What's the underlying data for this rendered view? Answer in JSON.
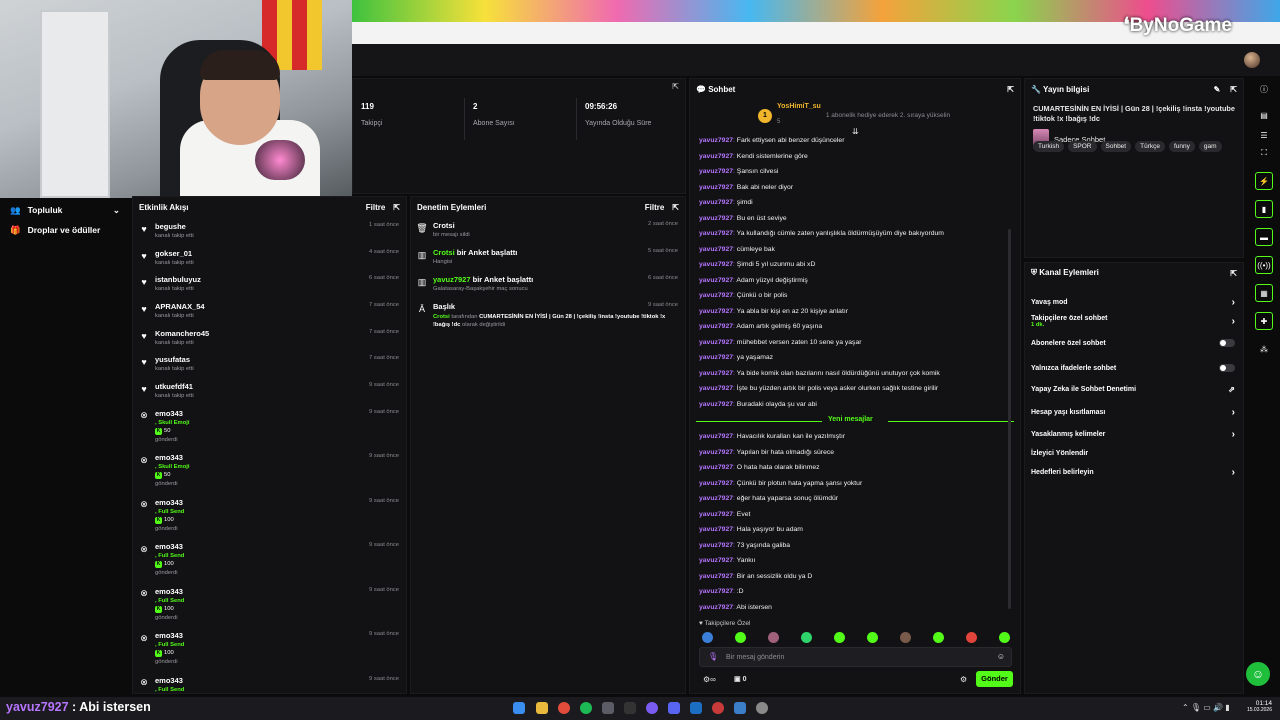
{
  "brand": {
    "logo_text": "ByNoGame"
  },
  "stats": [
    {
      "value": "119",
      "label": "Takipçi"
    },
    {
      "value": "2",
      "label": "Abone Sayısı"
    },
    {
      "value": "09:56:26",
      "label": "Yayında Olduğu Süre"
    }
  ],
  "sidebar": {
    "items": [
      {
        "label": "Topluluk",
        "icon": "community-icon"
      },
      {
        "label": "Droplar ve ödüller",
        "icon": "gift-icon"
      }
    ]
  },
  "activity": {
    "title": "Etkinlik Akışı",
    "filter": "Filtre",
    "items": [
      {
        "icon": "heart-icon",
        "name": "begushe",
        "sub": "kanalı takip etti",
        "time": "1 saat önce"
      },
      {
        "icon": "heart-icon",
        "name": "gokser_01",
        "sub": "kanalı takip etti",
        "time": "4 saat önce"
      },
      {
        "icon": "heart-icon",
        "name": "istanbuluyuz",
        "sub": "kanalı takip etti",
        "time": "6 saat önce"
      },
      {
        "icon": "heart-icon",
        "name": "APRANAX_54",
        "sub": "kanalı takip etti",
        "time": "7 saat önce"
      },
      {
        "icon": "heart-icon",
        "name": "Komanchero45",
        "sub": "kanalı takip etti",
        "time": "7 saat önce"
      },
      {
        "icon": "heart-icon",
        "name": "yusufatas",
        "sub": "kanalı takip etti",
        "time": "7 saat önce"
      },
      {
        "icon": "heart-icon",
        "name": "utkuefdf41",
        "sub": "kanalı takip etti",
        "time": "9 saat önce"
      },
      {
        "icon": "kick-icon",
        "name": "emo343",
        "gift": ", Skull Emoji",
        "amount": "50",
        "sub": "gönderdi",
        "time": "9 saat önce"
      },
      {
        "icon": "kick-icon",
        "name": "emo343",
        "gift": ", Skull Emoji",
        "amount": "50",
        "sub": "gönderdi",
        "time": "9 saat önce"
      },
      {
        "icon": "kick-icon",
        "name": "emo343",
        "gift": ", Full Send",
        "amount": "100",
        "sub": "gönderdi",
        "time": "9 saat önce"
      },
      {
        "icon": "kick-icon",
        "name": "emo343",
        "gift": ", Full Send",
        "amount": "100",
        "sub": "gönderdi",
        "time": "9 saat önce"
      },
      {
        "icon": "kick-icon",
        "name": "emo343",
        "gift": ", Full Send",
        "amount": "100",
        "sub": "gönderdi",
        "time": "9 saat önce"
      },
      {
        "icon": "kick-icon",
        "name": "emo343",
        "gift": ", Full Send",
        "amount": "100",
        "sub": "gönderdi",
        "time": "9 saat önce"
      },
      {
        "icon": "kick-icon",
        "name": "emo343",
        "gift": ", Full Send",
        "amount": "",
        "sub": "",
        "time": "9 saat önce"
      }
    ]
  },
  "moderation": {
    "title": "Denetim Eylemleri",
    "filter": "Filtre",
    "items": [
      {
        "icon": "trash-icon",
        "title": "Crotsi",
        "sub": "bir mesajı sildi",
        "time": "2 saat önce"
      },
      {
        "icon": "poll-icon",
        "user": "Crotsi",
        "title": " bir Anket başlattı",
        "sub": "Hangisi",
        "time": "5 saat önce"
      },
      {
        "icon": "poll-icon",
        "user": "yavuz7927",
        "title": " bir Anket başlattı",
        "sub": "Galatasaray-Başakşehir maç sonucu",
        "time": "6 saat önce"
      },
      {
        "icon": "title-icon",
        "title": "Başlık",
        "user": "Crotsi",
        "sub_mid": " tarafından ",
        "sub_bold": "CUMARTESİNİN EN İYİSİ | Gün 28 | !çekiliş !insta !youtube !tiktok !x !bağış !dc",
        "sub_end": " olarak değiştirildi",
        "time": "9 saat önce"
      }
    ]
  },
  "chat": {
    "title": "Sohbet",
    "pinned_user": "YosHimiT_su",
    "pinned_count": "5",
    "pinned_text": "1 abonelik hediye ederek 2. sıraya yükselin",
    "new_messages": "Yeni mesajlar",
    "messages_before": [
      {
        "user": "yavuz7927",
        "text": "Fark ettiysen abi benzer düşünceler"
      },
      {
        "user": "yavuz7927",
        "text": "Kendi sistemlerine göre"
      },
      {
        "user": "yavuz7927",
        "text": "Şansın cilvesi"
      },
      {
        "user": "yavuz7927",
        "text": "Bak abi neler diyor"
      },
      {
        "user": "yavuz7927",
        "text": "şimdi"
      },
      {
        "user": "yavuz7927",
        "text": "Bu en üst seviye"
      },
      {
        "user": "yavuz7927",
        "text": "Ya kullandığı cümle zaten yanlışlıkla öldürmüşüyüm diye bakıyordum"
      },
      {
        "user": "yavuz7927",
        "text": "cümleye bak"
      },
      {
        "user": "yavuz7927",
        "text": "Şimdi 5 yıl uzunmu abi xD"
      },
      {
        "user": "yavuz7927",
        "text": "Adam yüzyıl değiştirmiş"
      },
      {
        "user": "yavuz7927",
        "text": "Çünkü o bir polis"
      },
      {
        "user": "yavuz7927",
        "text": "Ya abla bir kişi en az 20 kişiye anlatır"
      },
      {
        "user": "yavuz7927",
        "text": "Adam artık gelmiş 60 yaşına"
      },
      {
        "user": "yavuz7927",
        "text": "mühebbet versen zaten 10 sene ya yaşar"
      },
      {
        "user": "yavuz7927",
        "text": "ya yaşamaz"
      },
      {
        "user": "yavuz7927",
        "text": "Ya bide komik olan bazılarını nasıl öldürdüğünü unutuyor çok komik"
      },
      {
        "user": "yavuz7927",
        "text": "İşte bu yüzden artık bir polis veya asker olurken sağlık testine girilir"
      },
      {
        "user": "yavuz7927",
        "text": "Buradaki olayda şu var abi"
      }
    ],
    "messages_after": [
      {
        "user": "yavuz7927",
        "text": "Havacılık kuralları kan ile yazılmıştır"
      },
      {
        "user": "yavuz7927",
        "text": "Yapılan bir hata olmadığı sürece"
      },
      {
        "user": "yavuz7927",
        "text": "O hata hata olarak bilinmez"
      },
      {
        "user": "yavuz7927",
        "text": "Çünkü bir plotun hata yapma şansı yoktur"
      },
      {
        "user": "yavuz7927",
        "text": "eğer hata yaparsa sonuç ölümdür"
      },
      {
        "user": "yavuz7927",
        "text": "Evet"
      },
      {
        "user": "yavuz7927",
        "text": "Hala yaşıyor bu adam"
      },
      {
        "user": "yavuz7927",
        "text": "73 yaşında galiba"
      },
      {
        "user": "yavuz7927",
        "text": "Yankıı"
      },
      {
        "user": "yavuz7927",
        "text": "Bir an sessizlik oldu ya D"
      },
      {
        "user": "yavuz7927",
        "text": ":D"
      },
      {
        "user": "yavuz7927",
        "text": "Abi istersen"
      }
    ],
    "followers_only": "Takipçilere Özel",
    "input_placeholder": "Bir mesaj gönderin",
    "points": "0",
    "send": "Gönder"
  },
  "stream_info": {
    "title": "Yayın bilgisi",
    "stream_title": "CUMARTESİNİN EN İYİSİ | Gün 28 | !çekiliş !insta !youtube !tiktok !x !bağış !dc",
    "category": "Sadece Sohbet",
    "tags": [
      "Turkish",
      "SPOR",
      "Sohbet",
      "Türkçe",
      "funny",
      "gam"
    ]
  },
  "channel_actions": {
    "title": "Kanal Eylemleri",
    "items": [
      {
        "label": "Yavaş mod",
        "control": "chevron"
      },
      {
        "label": "Takipçilere özel sohbet",
        "sub": "1 dk.",
        "control": "chevron"
      },
      {
        "label": "Abonelere özel sohbet",
        "control": "toggle"
      },
      {
        "label": "Yalnızca ifadelerle sohbet",
        "control": "toggle"
      },
      {
        "label": "Yapay Zeka ile Sohbet Denetimi",
        "control": "external"
      },
      {
        "label": "Hesap yaşı kısıtlaması",
        "control": "chevron"
      },
      {
        "label": "Yasaklanmış kelimeler",
        "control": "chevron"
      },
      {
        "label": "İzleyici Yönlendir",
        "control": "none"
      },
      {
        "label": "Hedefleri belirleyin",
        "control": "chevron"
      }
    ]
  },
  "overlay_chat": {
    "user": "yavuz7927",
    "sep": " : ",
    "text": "Abi istersen"
  },
  "clock": {
    "time": "01:14",
    "date": "15.03.2026"
  },
  "colors": {
    "accent": "#53fc18",
    "username": "#b675ff",
    "bg": "#0b0b0c",
    "panel": "#121214"
  }
}
